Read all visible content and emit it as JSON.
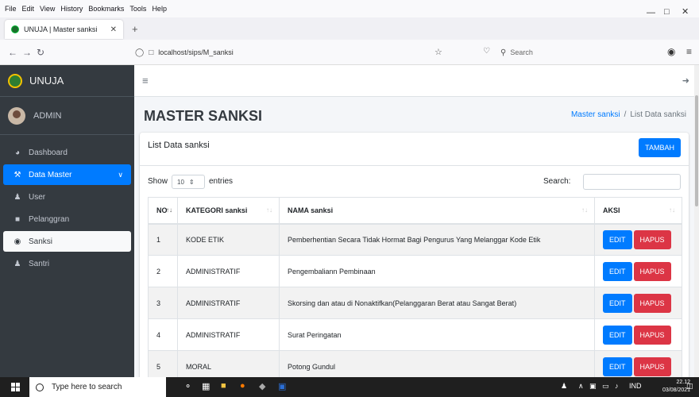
{
  "browser": {
    "menu": [
      "File",
      "Edit",
      "View",
      "History",
      "Bookmarks",
      "Tools",
      "Help"
    ],
    "tab_title": "UNUJA | Master sanksi",
    "url": "localhost/sips/M_sanksi",
    "search_placeholder": "Search"
  },
  "sidebar": {
    "brand": "UNUJA",
    "user": "ADMIN",
    "items": [
      {
        "label": "Dashboard",
        "icon": "dashboard-icon"
      },
      {
        "label": "Data Master",
        "icon": "wrench-icon"
      },
      {
        "label": "User",
        "icon": "user-icon"
      },
      {
        "label": "Pelanggran",
        "icon": "lock-icon"
      },
      {
        "label": "Sanksi",
        "icon": "eye-icon"
      },
      {
        "label": "Santri",
        "icon": "users-icon"
      }
    ]
  },
  "header": {
    "title": "MASTER SANKSI",
    "breadcrumb_link": "Master sanksi",
    "breadcrumb_separator": "/",
    "breadcrumb_current": "List Data sanksi"
  },
  "card": {
    "title": "List Data sanksi",
    "add_button": "TAMBAH"
  },
  "datatable": {
    "show_label": "Show",
    "length_value": "10",
    "entries_label": "entries",
    "search_label": "Search:",
    "columns": [
      "NO",
      "KATEGORI sanksi",
      "NAMA sanksi",
      "AKSI"
    ],
    "edit_label": "EDIT",
    "delete_label": "HAPUS",
    "rows": [
      {
        "no": "1",
        "kategori": "KODE ETIK",
        "nama": "Pemberhentian Secara Tidak Hormat Bagi Pengurus Yang Melanggar Kode Etik"
      },
      {
        "no": "2",
        "kategori": "ADMINISTRATIF",
        "nama": "Pengembaliann Pembinaan"
      },
      {
        "no": "3",
        "kategori": "ADMINISTRATIF",
        "nama": "Skorsing dan atau di Nonaktifkan(Pelanggaran Berat atau Sangat Berat)"
      },
      {
        "no": "4",
        "kategori": "ADMINISTRATIF",
        "nama": "Surat Peringatan"
      },
      {
        "no": "5",
        "kategori": "MORAL",
        "nama": "Potong Gundul"
      }
    ]
  },
  "taskbar": {
    "search_placeholder": "Type here to search",
    "lang": "IND",
    "time": "22.12",
    "date": "03/08/2021"
  }
}
